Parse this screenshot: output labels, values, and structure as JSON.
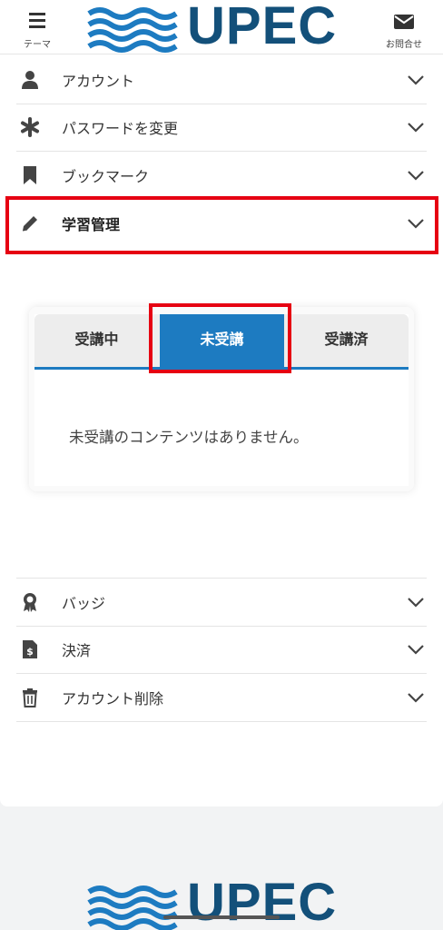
{
  "header": {
    "theme_label": "テーマ",
    "logo_text": "UPEC",
    "contact_label": "お問合せ",
    "icons": {
      "theme": "menu-icon",
      "contact": "envelope-icon"
    }
  },
  "menu_top": [
    {
      "label": "アカウント",
      "icon": "user-icon"
    },
    {
      "label": "パスワードを変更",
      "icon": "asterisk-icon"
    },
    {
      "label": "ブックマーク",
      "icon": "bookmark-icon"
    },
    {
      "label": "学習管理",
      "icon": "pencil-icon"
    }
  ],
  "tabs": {
    "items": [
      "受講中",
      "未受講",
      "受講済"
    ],
    "selected": "未受講",
    "empty_message": "未受講のコンテンツはありません。"
  },
  "menu_bottom": [
    {
      "label": "バッジ",
      "icon": "badge-icon"
    },
    {
      "label": "決済",
      "icon": "invoice-icon"
    },
    {
      "label": "アカウント削除",
      "icon": "trash-icon"
    }
  ],
  "footer": {
    "logo_text": "UPEC"
  },
  "colors": {
    "brand": "#13507a",
    "accent": "#1d7bc1",
    "highlight": "#e60012"
  }
}
